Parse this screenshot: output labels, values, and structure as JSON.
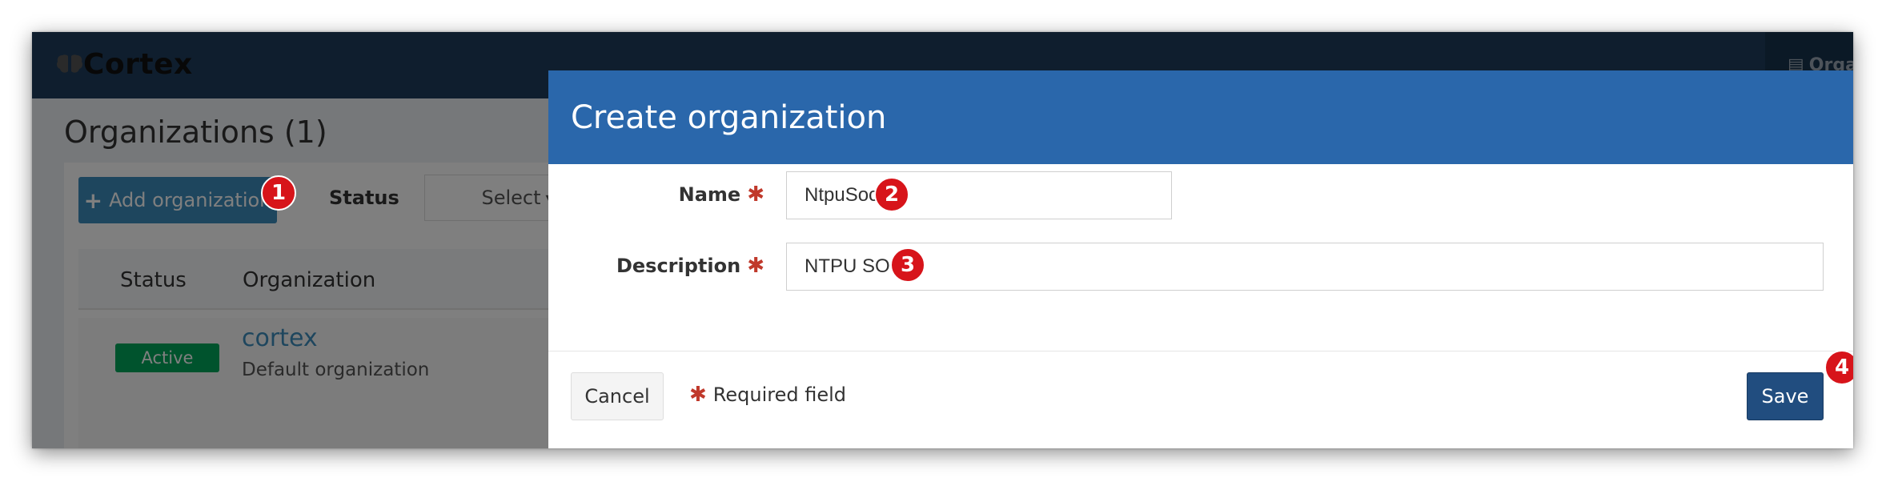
{
  "header": {
    "app_name": "Cortex",
    "top_right_label": "Orga"
  },
  "page": {
    "title": "Organizations (1)",
    "add_button_label": "Add organization",
    "status_filter_label": "Status",
    "status_select_value": "Select",
    "table": {
      "columns": [
        "Status",
        "Organization"
      ],
      "rows": [
        {
          "status": "Active",
          "name": "cortex",
          "description": "Default organization"
        }
      ]
    }
  },
  "modal": {
    "title": "Create organization",
    "name_label": "Name",
    "name_value": "NtpuSoc",
    "description_label": "Description",
    "description_value": "NTPU SOC",
    "cancel_label": "Cancel",
    "required_note": "Required field",
    "save_label": "Save"
  },
  "markers": [
    "1",
    "2",
    "3",
    "4"
  ],
  "colors": {
    "topbar": "#1e3d5c",
    "modal_header": "#2a67ab",
    "primary_button": "#3c8dbc",
    "save_button": "#214d7f",
    "status_active": "#00a65a",
    "required_star": "#c0392b",
    "marker": "#d7141a"
  }
}
